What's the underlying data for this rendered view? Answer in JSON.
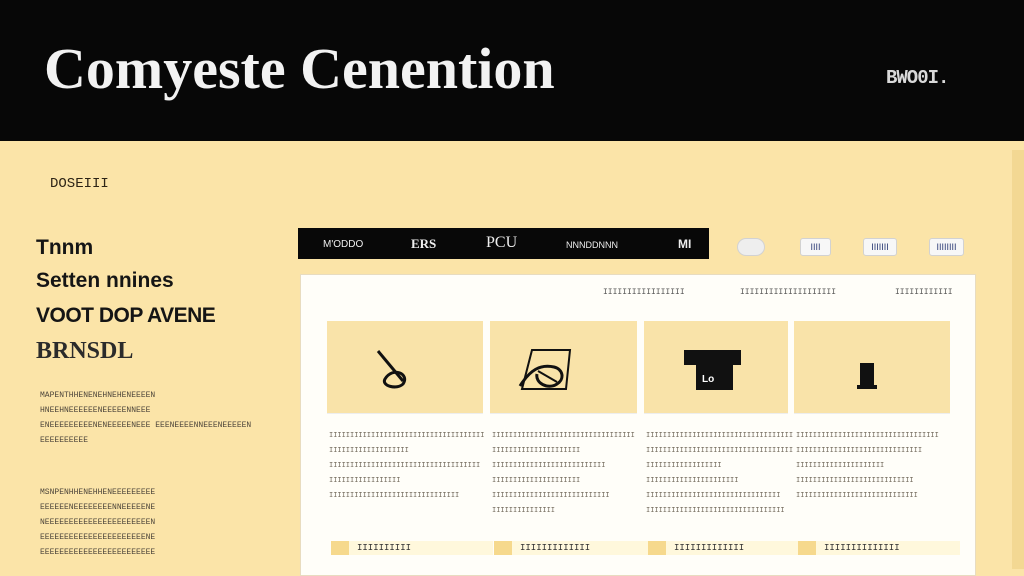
{
  "header": {
    "brand": "Comyeste Cenention",
    "user": "BWO0I."
  },
  "left": {
    "breadcrumb": "DOSEIII",
    "hero": [
      "Tnnm",
      "Setten nnines",
      "VOOT DOP AVENE",
      "BRNSDL"
    ],
    "paragraph1": "MAPENTHHENENEHNEHENEEEEN HNEEHNEEEEEENEEEEENNEEE ENEEEEEEEEENENEEEEENEEE EEENEEEENNEEENEEEEEN EEEEEEEEEE",
    "paragraph2": "MSNPENHHENEHHENEEEEEEEEE EEEEEENEEEEEEEENNEEEEENE NEEEEEEEEEEEEEEEEEEEEEEN EEEEEEEEEEEEEEEEEEEEEENE EEEEEEEEEEEEEEEEEEEEEEEE"
  },
  "nav": {
    "items": [
      "M'ODDO",
      "ERS",
      "PCU",
      "NNNDDNNN",
      "MI"
    ],
    "pills": [
      "",
      "IIII",
      "IIIIIII",
      "IIIIIIII"
    ]
  },
  "filters": [
    "IIIIIIIIIIIIIIIII",
    "IIIIIIIIIIIIIIIIIIII",
    "IIIIIIIIIIII"
  ],
  "cards": [
    {
      "icon": "quill-icon",
      "text": [
        "IIIIIIIIIIIIIIIIIIIIIIIIIIIIIIIIIIIII",
        "IIIIIIIIIIIIIIIIIII",
        "IIIIIIIIIIIIIIIIIIIIIIIIIIIIIIIIIIII",
        "IIIIIIIIIIIIIIIII",
        "IIIIIIIIIIIIIIIIIIIIIIIIIIIIIII"
      ],
      "link": "IIIIIIIIII"
    },
    {
      "icon": "hand-icon",
      "text": [
        "IIIIIIIIIIIIIIIIIIIIIIIIIIIIIIIIII",
        "IIIIIIIIIIIIIIIIIIIII",
        "IIIIIIIIIIIIIIIIIIIIIIIIIII",
        "IIIIIIIIIIIIIIIIIIIII",
        "IIIIIIIIIIIIIIIIIIIIIIIIIIII",
        "IIIIIIIIIIIIIII"
      ],
      "link": "IIIIIIIIIIIII"
    },
    {
      "icon": "badge-icon",
      "text": [
        "IIIIIIIIIIIIIIIIIIIIIIIIIIIIIIIIIII",
        "IIIIIIIIIIIIIIIIIIIIIIIIIIIIIIIIIII",
        "IIIIIIIIIIIIIIIIII",
        "IIIIIIIIIIIIIIIIIIIIII",
        "IIIIIIIIIIIIIIIIIIIIIIIIIIIIIIII",
        "IIIIIIIIIIIIIIIIIIIIIIIIIIIIIIIII"
      ],
      "link": "IIIIIIIIIIIII"
    },
    {
      "icon": "book-icon",
      "text": [
        "IIIIIIIIIIIIIIIIIIIIIIIIIIIIIIIIII",
        "IIIIIIIIIIIIIIIIIIIIIIIIIIIIII",
        "IIIIIIIIIIIIIIIIIIIII",
        "IIIIIIIIIIIIIIIIIIIIIIIIIIII",
        "IIIIIIIIIIIIIIIIIIIIIIIIIIIII"
      ],
      "link": "IIIIIIIIIIIIII"
    }
  ]
}
